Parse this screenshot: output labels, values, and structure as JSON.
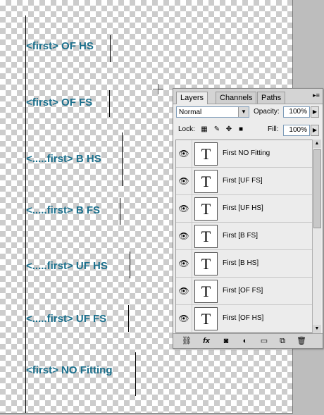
{
  "canvas": {
    "lines": [
      "<first> OF HS",
      "<first> OF FS",
      "<.....first> B HS",
      "<.....first> B FS",
      "<.....first> UF HS",
      "<.....first> UF FS",
      "<first> NO Fitting"
    ]
  },
  "panel": {
    "tabs": [
      "Layers",
      "Channels",
      "Paths"
    ],
    "blend_mode": "Normal",
    "opacity_label": "Opacity:",
    "opacity_value": "100%",
    "lock_label": "Lock:",
    "fill_label": "Fill:",
    "fill_value": "100%",
    "layers": [
      {
        "thumb": "T",
        "name": "First NO Fitting"
      },
      {
        "thumb": "T",
        "name": "First [UF FS]"
      },
      {
        "thumb": "T",
        "name": "First [UF HS]"
      },
      {
        "thumb": "T",
        "name": "First [B FS]"
      },
      {
        "thumb": "T",
        "name": "First [B HS]"
      },
      {
        "thumb": "T",
        "name": "First [OF FS]"
      },
      {
        "thumb": "T",
        "name": "First [OF HS]"
      }
    ],
    "bottom_icons": [
      "link-icon",
      "fx-icon",
      "mask-icon",
      "adjustment-icon",
      "folder-icon",
      "new-layer-icon",
      "trash-icon"
    ],
    "text_color": "#1a6f8c"
  }
}
